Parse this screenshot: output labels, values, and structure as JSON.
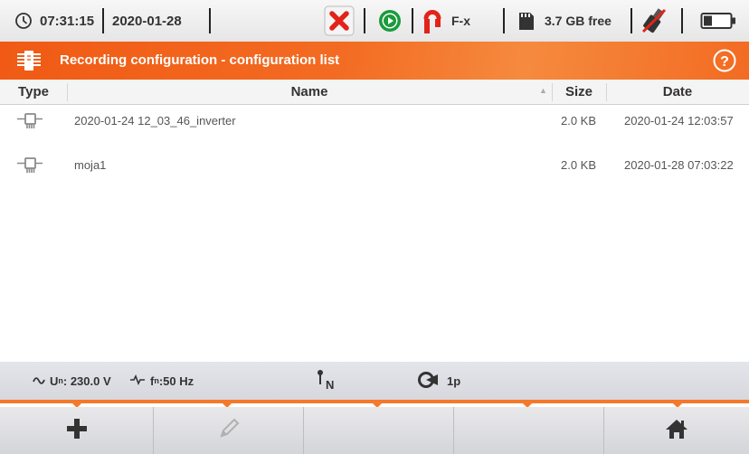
{
  "status_bar": {
    "time": "07:31:15",
    "date": "2020-01-28",
    "clamp_type": "F-x",
    "memory_free": "3.7 GB free"
  },
  "title_bar": {
    "title": "Recording configuration - configuration list"
  },
  "table": {
    "columns": [
      "Type",
      "Name",
      "Size",
      "Date"
    ],
    "rows": [
      {
        "name": "2020-01-24 12_03_46_inverter",
        "size": "2.0 KB",
        "date": "2020-01-24 12:03:57"
      },
      {
        "name": "moja1",
        "size": "2.0 KB",
        "date": "2020-01-28 07:03:22"
      }
    ]
  },
  "info_bar": {
    "voltage_label": "U",
    "voltage_sub": "n",
    "voltage_value": ": 230.0 V",
    "freq_label": "f",
    "freq_sub": "n",
    "freq_value": ":50 Hz",
    "neutral_label": "N",
    "system_label": "1p"
  },
  "colors": {
    "accent_orange": "#f36b22",
    "status_red": "#e2231a",
    "status_green": "#1a9b3c"
  },
  "icons": [
    "clock-icon",
    "stop-recording-icon",
    "play-recording-icon",
    "clamp-icon",
    "sd-card-icon",
    "usb-disconnected-icon",
    "battery-icon",
    "config-module-icon",
    "help-icon",
    "sine-wave-icon",
    "frequency-icon",
    "neutral-probe-icon",
    "network-system-icon",
    "add-icon",
    "edit-icon",
    "home-icon"
  ]
}
